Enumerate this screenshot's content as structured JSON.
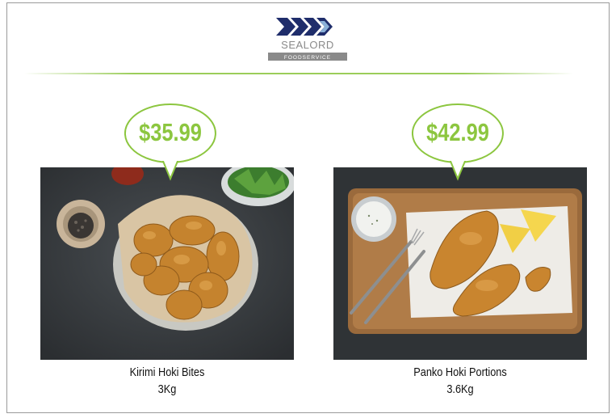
{
  "brand": {
    "name": "SEALORD",
    "tagline": "FOODSERVICE",
    "colors": {
      "navy": "#1f2d6b",
      "gray": "#8a8a8a",
      "accent": "#8cc63f"
    }
  },
  "products": [
    {
      "price": "$35.99",
      "name": "Kirimi Hoki Bites",
      "size": "3Kg",
      "image": "fried-fish-bites-bowl"
    },
    {
      "price": "$42.99",
      "name": "Panko Hoki Portions",
      "size": "3.6Kg",
      "image": "panko-fish-fillets-board"
    }
  ]
}
